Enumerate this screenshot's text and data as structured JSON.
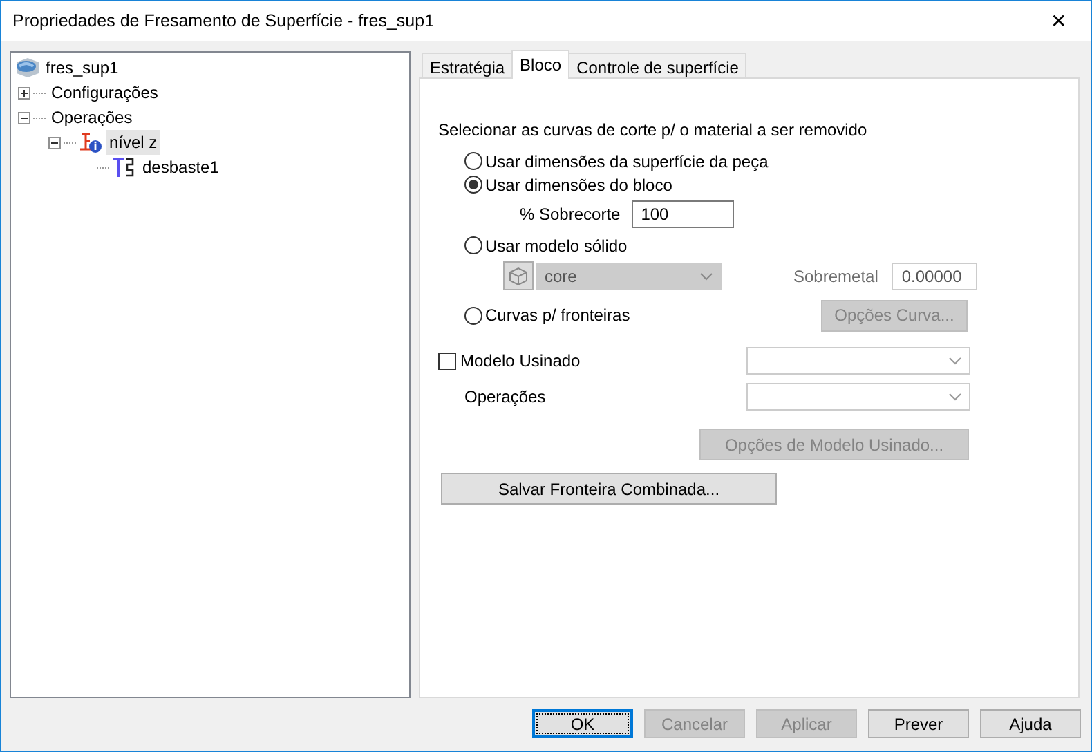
{
  "window": {
    "title": "Propriedades de Fresamento de Superfície - fres_sup1",
    "close": "✕"
  },
  "tree": [
    {
      "label": "fres_sup1",
      "kind": "model",
      "selected": false,
      "children": [
        {
          "label": "Configurações",
          "kind": "folder",
          "expanded": false,
          "selected": false
        },
        {
          "label": "Operações",
          "kind": "folder",
          "expanded": true,
          "selected": false,
          "children": [
            {
              "label": "nível z",
              "kind": "operation",
              "expanded": true,
              "selected": true,
              "children": [
                {
                  "label": "desbaste1",
                  "kind": "toolpath",
                  "selected": false
                }
              ]
            }
          ]
        }
      ]
    }
  ],
  "tabs": [
    {
      "label": "Estratégia",
      "selected": false
    },
    {
      "label": "Bloco",
      "selected": true
    },
    {
      "label": "Controle de superfície",
      "selected": false
    }
  ],
  "bloco": {
    "heading": "Selecionar as curvas de corte p/ o material a ser removido",
    "options": [
      {
        "kind": "radio",
        "label": "Usar dimensões da superfície da peça",
        "selected": false
      },
      {
        "kind": "radio",
        "label": "Usar dimensões do bloco",
        "selected": true
      },
      {
        "kind": "overcut",
        "label": "% Sobrecorte",
        "value": "100"
      },
      {
        "kind": "radio",
        "label": "Usar modelo sólido",
        "selected": false
      },
      {
        "kind": "solid",
        "value": "core",
        "disabled": true,
        "stock_label": "Sobremetal",
        "stock_value": "0.00000"
      },
      {
        "kind": "radio",
        "label": "Curvas p/ fronteiras",
        "selected": false,
        "button": "Opções Curva...",
        "button_disabled": true
      }
    ],
    "machined": {
      "label": "Modelo Usinado",
      "checked": false
    },
    "operations_label": "Operações",
    "machined_button": {
      "label": "Opções de Modelo Usinado...",
      "disabled": true
    },
    "save_button": {
      "label": "Salvar Fronteira Combinada...",
      "disabled": false
    }
  },
  "footer": [
    {
      "label": "OK",
      "disabled": false,
      "default": true
    },
    {
      "label": "Cancelar",
      "disabled": true,
      "default": false
    },
    {
      "label": "Aplicar",
      "disabled": true,
      "default": false
    },
    {
      "label": "Prever",
      "disabled": false,
      "default": false
    },
    {
      "label": "Ajuda",
      "disabled": false,
      "default": false
    }
  ]
}
